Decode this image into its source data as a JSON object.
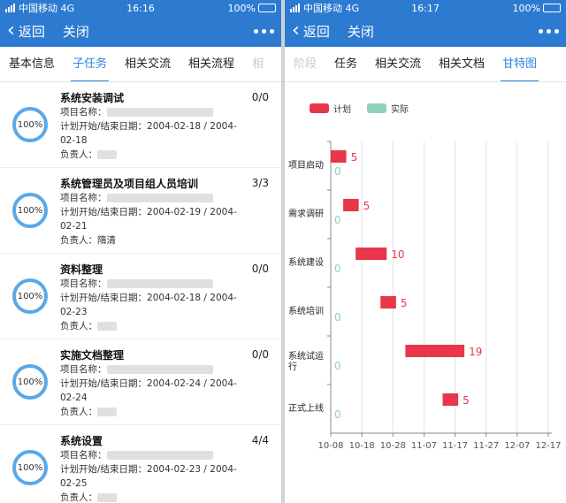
{
  "status_left": {
    "carrier": "中国移动",
    "network": "4G",
    "time": "16:16",
    "battery": "100%"
  },
  "status_right": {
    "carrier": "中国移动",
    "network": "4G",
    "time": "16:17",
    "battery": "100%"
  },
  "nav": {
    "back": "返回",
    "close": "关闭"
  },
  "left_tabs": [
    "基本信息",
    "子任务",
    "相关交流",
    "相关流程",
    "相"
  ],
  "right_tabs": [
    "阶段",
    "任务",
    "相关交流",
    "相关文档",
    "甘特图"
  ],
  "labels": {
    "project": "项目名称：",
    "dates": "计划开始/结束日期：",
    "owner": "负责人："
  },
  "tasks": [
    {
      "title": "系统安装调试",
      "count": "0/0",
      "progress": "100%",
      "dates1": "2004-02-18 / 2004-",
      "dates2": "02-18",
      "owner": ""
    },
    {
      "title": "系统管理员及项目组人员培训",
      "count": "3/3",
      "progress": "100%",
      "dates1": "2004-02-19 / 2004-",
      "dates2": "02-21",
      "owner": "隋清"
    },
    {
      "title": "资料整理",
      "count": "0/0",
      "progress": "100%",
      "dates1": "2004-02-18 / 2004-",
      "dates2": "02-23",
      "owner": ""
    },
    {
      "title": "实施文档整理",
      "count": "0/0",
      "progress": "100%",
      "dates1": "2004-02-24 / 2004-",
      "dates2": "02-24",
      "owner": ""
    },
    {
      "title": "系统设置",
      "count": "4/4",
      "progress": "100%",
      "dates1": "2004-02-23 / 2004-",
      "dates2": "02-25",
      "owner": ""
    }
  ],
  "colors": {
    "brand": "#2d7bd1",
    "plan": "#e8364a",
    "actual": "#8fd3b8",
    "ring": "#59a8e8"
  },
  "chart_data": {
    "type": "bar",
    "orientation": "horizontal",
    "legend": [
      "计划",
      "实际"
    ],
    "legend_position": "top-left",
    "categories": [
      "项目启动",
      "需求调研",
      "系统建设",
      "系统培训",
      "系统试运行",
      "正式上线"
    ],
    "category_lines": [
      [
        "项目启动"
      ],
      [
        "需求调研"
      ],
      [
        "系统建设"
      ],
      [
        "系统培训"
      ],
      [
        "系统试运",
        "行"
      ],
      [
        "正式上线"
      ]
    ],
    "series": [
      {
        "name": "计划",
        "start": [
          "10-08",
          "10-12",
          "10-16",
          "10-24",
          "11-01",
          "11-13"
        ],
        "duration_days": [
          5,
          5,
          10,
          5,
          19,
          5
        ]
      },
      {
        "name": "实际",
        "duration_days": [
          0,
          0,
          0,
          0,
          0,
          0
        ]
      }
    ],
    "x_ticks": [
      "10-08",
      "10-18",
      "10-28",
      "11-07",
      "11-17",
      "11-27",
      "12-07",
      "12-17"
    ],
    "x_range": [
      "10-08",
      "12-17"
    ],
    "grid": "vertical"
  }
}
